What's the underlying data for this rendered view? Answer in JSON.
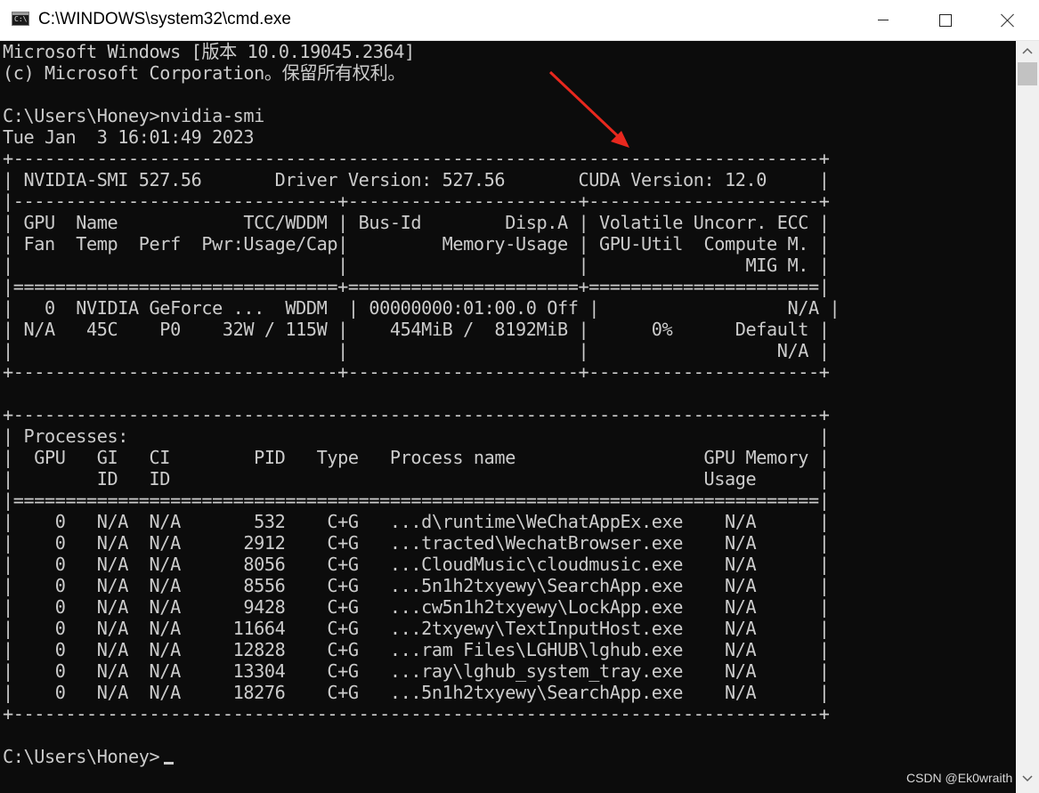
{
  "window": {
    "title": "C:\\WINDOWS\\system32\\cmd.exe",
    "icon": "cmd-console-icon",
    "icon_label": "C:\\"
  },
  "controls": {
    "minimize_icon": "minimize-icon",
    "maximize_icon": "maximize-icon",
    "close_icon": "close-icon"
  },
  "terminal": {
    "lines": [
      "Microsoft Windows [版本 10.0.19045.2364]",
      "(c) Microsoft Corporation。保留所有权利。",
      "",
      "C:\\Users\\Honey>nvidia-smi",
      "Tue Jan  3 16:01:49 2023",
      "+-----------------------------------------------------------------------------+",
      "| NVIDIA-SMI 527.56       Driver Version: 527.56       CUDA Version: 12.0     |",
      "|-------------------------------+----------------------+----------------------+",
      "| GPU  Name            TCC/WDDM | Bus-Id        Disp.A | Volatile Uncorr. ECC |",
      "| Fan  Temp  Perf  Pwr:Usage/Cap|         Memory-Usage | GPU-Util  Compute M. |",
      "|                               |                      |               MIG M. |",
      "|===============================+======================+======================|",
      "|   0  NVIDIA GeForce ...  WDDM  | 00000000:01:00.0 Off |                  N/A |",
      "| N/A   45C    P0    32W / 115W |    454MiB /  8192MiB |      0%      Default |",
      "|                               |                      |                  N/A |",
      "+-------------------------------+----------------------+----------------------+",
      "",
      "+-----------------------------------------------------------------------------+",
      "| Processes:                                                                  |",
      "|  GPU   GI   CI        PID   Type   Process name                  GPU Memory |",
      "|        ID   ID                                                   Usage      |",
      "|=============================================================================|",
      "|    0   N/A  N/A       532    C+G   ...d\\runtime\\WeChatAppEx.exe    N/A      |",
      "|    0   N/A  N/A      2912    C+G   ...tracted\\WechatBrowser.exe    N/A      |",
      "|    0   N/A  N/A      8056    C+G   ...CloudMusic\\cloudmusic.exe    N/A      |",
      "|    0   N/A  N/A      8556    C+G   ...5n1h2txyewy\\SearchApp.exe    N/A      |",
      "|    0   N/A  N/A      9428    C+G   ...cw5n1h2txyewy\\LockApp.exe    N/A      |",
      "|    0   N/A  N/A     11664    C+G   ...2txyewy\\TextInputHost.exe    N/A      |",
      "|    0   N/A  N/A     12828    C+G   ...ram Files\\LGHUB\\lghub.exe    N/A      |",
      "|    0   N/A  N/A     13304    C+G   ...ray\\lghub_system_tray.exe    N/A      |",
      "|    0   N/A  N/A     18276    C+G   ...5n1h2txyewy\\SearchApp.exe    N/A      |",
      "+-----------------------------------------------------------------------------+",
      "",
      "C:\\Users\\Honey>"
    ]
  },
  "scrollbar": {
    "up_icon": "scroll-up-arrow-icon",
    "down_icon": "scroll-down-arrow-icon"
  },
  "annotation": {
    "arrow_icon": "red-arrow-icon",
    "color": "#e8281e"
  },
  "watermark": "CSDN @Ek0wraith"
}
